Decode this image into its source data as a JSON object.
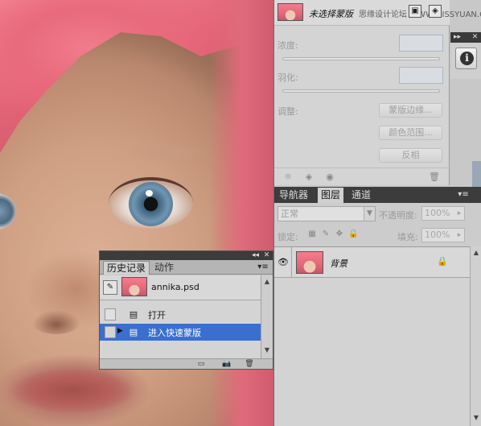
{
  "mask_panel": {
    "title": "未选择蒙版",
    "watermark": "思缘设计论坛 WWW.MISSYUAN.COM",
    "density_label": "浓度:",
    "feather_label": "羽化:",
    "adjust_label": "调整:",
    "buttons": [
      "蒙版边缘...",
      "颜色范围...",
      "反相"
    ]
  },
  "layers_panel": {
    "tabs": [
      "导航器",
      "图层",
      "通道"
    ],
    "active_tab": "图层",
    "blend_mode": "正常",
    "opacity_label": "不透明度:",
    "opacity_value": "100%",
    "lock_label": "锁定:",
    "fill_label": "填充:",
    "fill_value": "100%",
    "layer_name": "背景"
  },
  "history_panel": {
    "tabs": [
      "历史记录",
      "动作"
    ],
    "active_tab": "历史记录",
    "snapshot_name": "annika.psd",
    "states": [
      "打开",
      "进入快速蒙版"
    ],
    "selected_state": "进入快速蒙版"
  },
  "colors": {
    "selection": "#3a6fd0",
    "panel_bg": "#cccccc",
    "titlebar": "#3c3c3c"
  }
}
